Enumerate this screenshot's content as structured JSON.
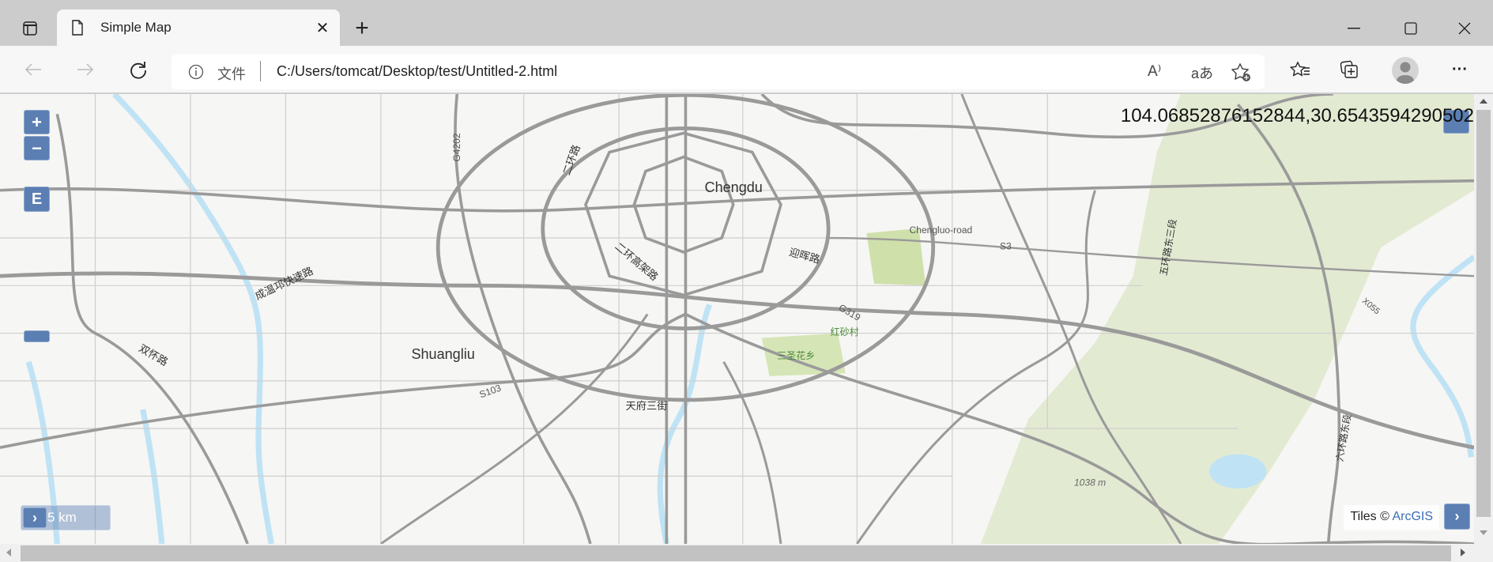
{
  "browser": {
    "tab_title": "Simple Map",
    "address_prefix": "文件",
    "url": "C:/Users/tomcat/Desktop/test/Untitled-2.html",
    "read_aloud_label": "A⁾",
    "translate_label": "aあ"
  },
  "map": {
    "coordinates": "104.06852876152844,30.6543594290502",
    "zoom_in": "+",
    "zoom_out": "−",
    "extent_button": "E",
    "scale_label": "5 km",
    "scale_toggle": "›",
    "attribution_prefix": "Tiles © ",
    "attribution_link": "ArcGIS",
    "attribution_toggle": "›",
    "labels": {
      "chengdu": "Chengdu",
      "shuangliu": "Shuangliu",
      "chengluo": "Chengluo-road",
      "s3": "S3",
      "g319": "G319",
      "hongsha": "红砂村",
      "sansheng": "三圣花乡",
      "tianfu": "天府三街",
      "yinghui": "迎晖路",
      "elevation": "1038 m",
      "s103": "S103",
      "g4202": "G4202",
      "erhuan": "二环路",
      "erhuan_gaojia": "二环高架路",
      "chengwen": "成温邛快速路",
      "shuanghuai": "双怀路",
      "wuhuan": "五环路东三段",
      "liuhuan": "六环路东段",
      "x055": "X055"
    },
    "colors": {
      "button": "#5b7fb3",
      "hills": "#e3ead2",
      "water": "#bfe3f5",
      "park": "#cfe0ab",
      "road": "#9a9a9a"
    }
  }
}
